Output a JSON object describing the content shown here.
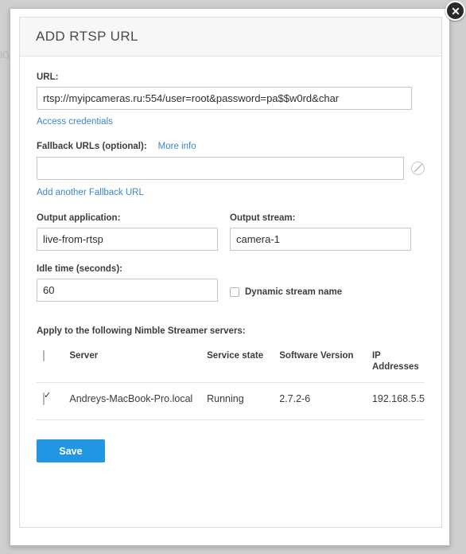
{
  "colors": {
    "accent": "#2196e3",
    "link": "#3a87c8",
    "header_bg": "#f7f7f7",
    "page_bg": "#cfcfcf",
    "text": "#3d3d3d",
    "border": "#c4c4c4"
  },
  "background": {
    "gutter_text": "IG"
  },
  "modal": {
    "title": "ADD RTSP URL",
    "close_label": "close-icon"
  },
  "form": {
    "url": {
      "label": "URL:",
      "value": "rtsp://myipcameras.ru:554/user=root&password=pa$$w0rd&char",
      "placeholder": "",
      "helper_link": "Access credentials"
    },
    "fallback": {
      "label": "Fallback URLs (optional):",
      "more_info_link": "More info",
      "value": "",
      "placeholder": "",
      "remove_icon": "circle-slash-icon",
      "add_link": "Add another Fallback URL"
    },
    "output_application": {
      "label": "Output application:",
      "value": "live-from-rtsp",
      "placeholder": ""
    },
    "output_stream": {
      "label": "Output stream:",
      "value": "camera-1",
      "placeholder": ""
    },
    "idle_time": {
      "label": "Idle time (seconds):",
      "value": "60",
      "placeholder": ""
    },
    "dynamic_stream_name": {
      "label": "Dynamic stream name",
      "checked": false
    }
  },
  "servers": {
    "title": "Apply to the following Nimble Streamer servers:",
    "select_all_checked": false,
    "columns": [
      "Server",
      "Service state",
      "Software Version",
      "IP Addresses"
    ],
    "rows": [
      {
        "checked": true,
        "server": "Andreys-MacBook-Pro.local",
        "service_state": "Running",
        "software_version": "2.7.2-6",
        "ip_addresses": "192.168.5.5"
      }
    ]
  },
  "actions": {
    "save_label": "Save"
  }
}
